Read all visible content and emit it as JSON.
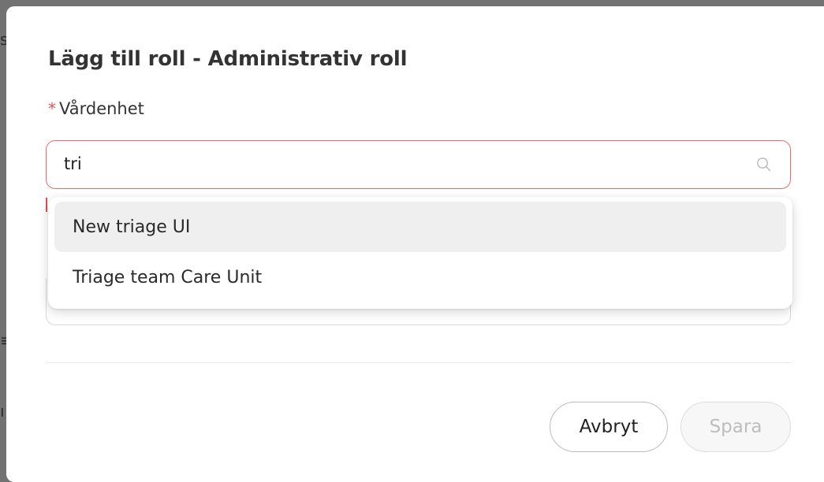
{
  "dialog": {
    "title": "Lägg till roll - Administrativ roll",
    "field": {
      "required_marker": "*",
      "label": "Vårdenhet",
      "value": "tri"
    },
    "dropdown": {
      "options": [
        {
          "label": "New triage UI",
          "highlighted": true
        },
        {
          "label": "Triage team Care Unit",
          "highlighted": false
        }
      ]
    },
    "buttons": {
      "cancel_label": "Avbryt",
      "save_label": "Spara",
      "save_disabled": true
    }
  },
  "colors": {
    "error": "#e0514f",
    "highlight": "#efefef",
    "disabled_text": "#bdbdbd"
  }
}
